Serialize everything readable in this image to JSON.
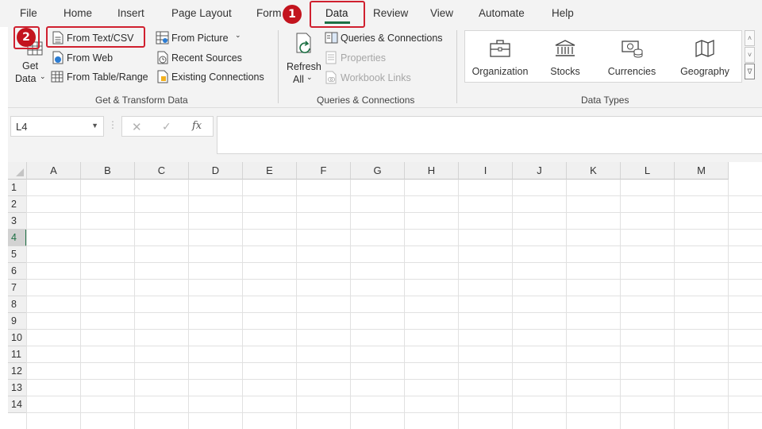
{
  "menu": {
    "tabs": [
      {
        "label": "File"
      },
      {
        "label": "Home"
      },
      {
        "label": "Insert"
      },
      {
        "label": "Page Layout"
      },
      {
        "label": "Form"
      },
      {
        "label": "Data"
      },
      {
        "label": "Review"
      },
      {
        "label": "View"
      },
      {
        "label": "Automate"
      },
      {
        "label": "Help"
      }
    ],
    "active_tab": "Data"
  },
  "ribbon": {
    "get_transform": {
      "get_data_label_1": "Get",
      "get_data_label_2": "Data",
      "from_text_csv": "From Text/CSV",
      "from_web": "From Web",
      "from_table_range": "From Table/Range",
      "from_picture": "From Picture",
      "recent_sources": "Recent Sources",
      "existing_connections": "Existing Connections",
      "group_label": "Get & Transform Data"
    },
    "queries": {
      "refresh_label_1": "Refresh",
      "refresh_label_2": "All",
      "queries_connections": "Queries & Connections",
      "properties": "Properties",
      "workbook_links": "Workbook Links",
      "group_label": "Queries & Connections"
    },
    "data_types": {
      "items": [
        {
          "label": "Organization"
        },
        {
          "label": "Stocks"
        },
        {
          "label": "Currencies"
        },
        {
          "label": "Geography"
        }
      ],
      "group_label": "Data Types"
    }
  },
  "formula_bar": {
    "name_box": "L4",
    "formula": ""
  },
  "sheet": {
    "columns": [
      "A",
      "B",
      "C",
      "D",
      "E",
      "F",
      "G",
      "H",
      "I",
      "J",
      "K",
      "L",
      "M"
    ],
    "rows": [
      "1",
      "2",
      "3",
      "4",
      "5",
      "6",
      "7",
      "8",
      "9",
      "10",
      "11",
      "12",
      "13",
      "14"
    ],
    "selected_row": "4"
  },
  "annotations": {
    "step1": "1",
    "step2": "2"
  },
  "colors": {
    "excel_green": "#1d7044",
    "annotation_red": "#c3141e",
    "ribbon_bg": "#f3f3f3"
  }
}
